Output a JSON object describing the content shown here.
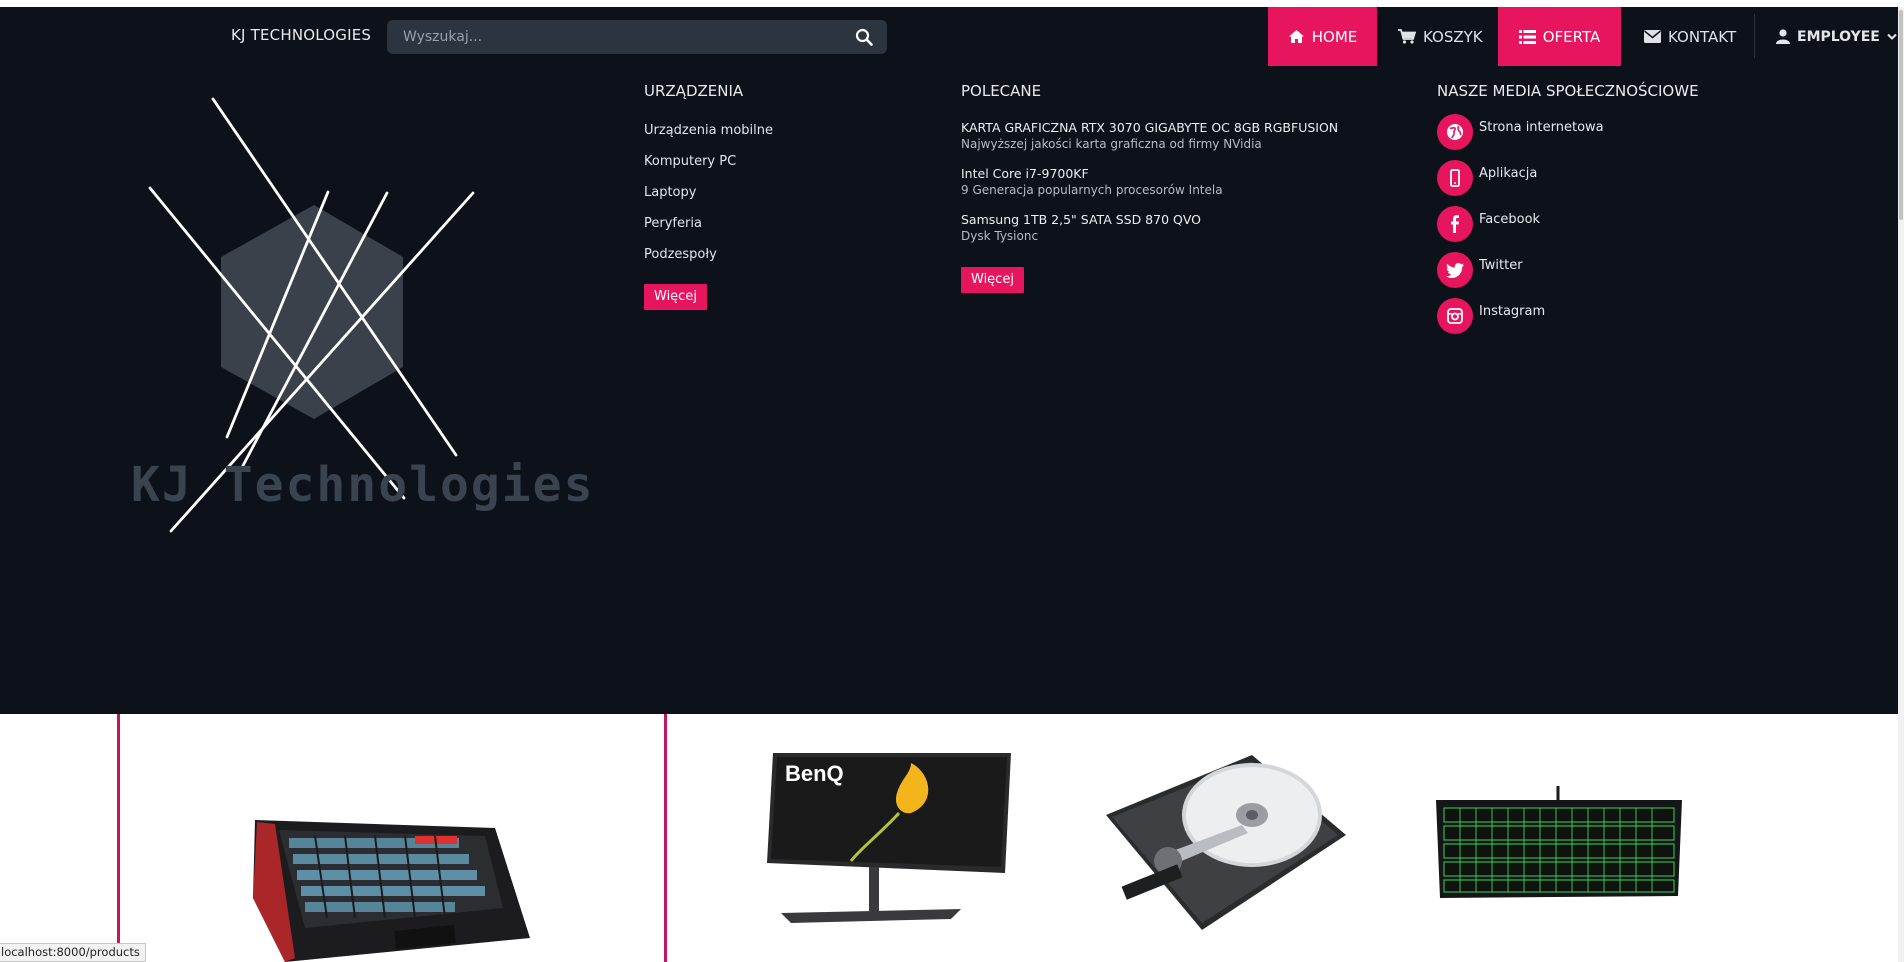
{
  "navbar": {
    "brand": "KJ TECHNOLOGIES",
    "search_placeholder": "Wyszukaj...",
    "items": [
      {
        "label": "HOME",
        "icon": "home-icon",
        "active": true
      },
      {
        "label": "KOSZYK",
        "icon": "cart-icon",
        "active": false
      },
      {
        "label": "OFERTA",
        "icon": "list-icon",
        "active": true
      },
      {
        "label": "KONTAKT",
        "icon": "envelope-icon",
        "active": false
      },
      {
        "label": "EMPLOYEE",
        "icon": "user-icon",
        "active": false
      }
    ]
  },
  "logo": {
    "text": "KJ Technologies"
  },
  "devices": {
    "title": "URZĄDZENIA",
    "links": [
      "Urządzenia mobilne",
      "Komputery PC",
      "Laptopy",
      "Peryferia",
      "Podzespoły"
    ],
    "more": "Więcej"
  },
  "recommended": {
    "title": "POLECANE",
    "items": [
      {
        "title": "KARTA GRAFICZNA RTX 3070 GIGABYTE OC 8GB RGBFUSION",
        "subtitle": "Najwyższej jakości karta graficzna od firmy NVidia"
      },
      {
        "title": "Intel Core i7-9700KF",
        "subtitle": "9 Generacja popularnych procesorów Intela"
      },
      {
        "title": "Samsung 1TB 2,5\" SATA SSD 870 QVO",
        "subtitle": "Dysk Tysionc"
      }
    ],
    "more": "Więcej"
  },
  "social": {
    "title": "NASZE MEDIA SPOŁECZNOŚCIOWE",
    "items": [
      {
        "label": "Strona internetowa",
        "icon": "globe-icon"
      },
      {
        "label": "Aplikacja",
        "icon": "mobile-icon"
      },
      {
        "label": "Facebook",
        "icon": "facebook-icon"
      },
      {
        "label": "Twitter",
        "icon": "twitter-icon"
      },
      {
        "label": "Instagram",
        "icon": "instagram-icon"
      }
    ]
  },
  "products": [
    {
      "name": "keyboard-gaming-rgb",
      "brand_text": ""
    },
    {
      "name": "monitor-benq",
      "brand_text": "BenQ"
    },
    {
      "name": "hard-disk-drive",
      "brand_text": ""
    },
    {
      "name": "keyboard-green-backlit",
      "brand_text": ""
    }
  ],
  "statusbar": {
    "url": "localhost:8000/products"
  },
  "colors": {
    "accent": "#e6155e",
    "background_dark": "#0d1119",
    "product_divider": "#c2185b"
  }
}
